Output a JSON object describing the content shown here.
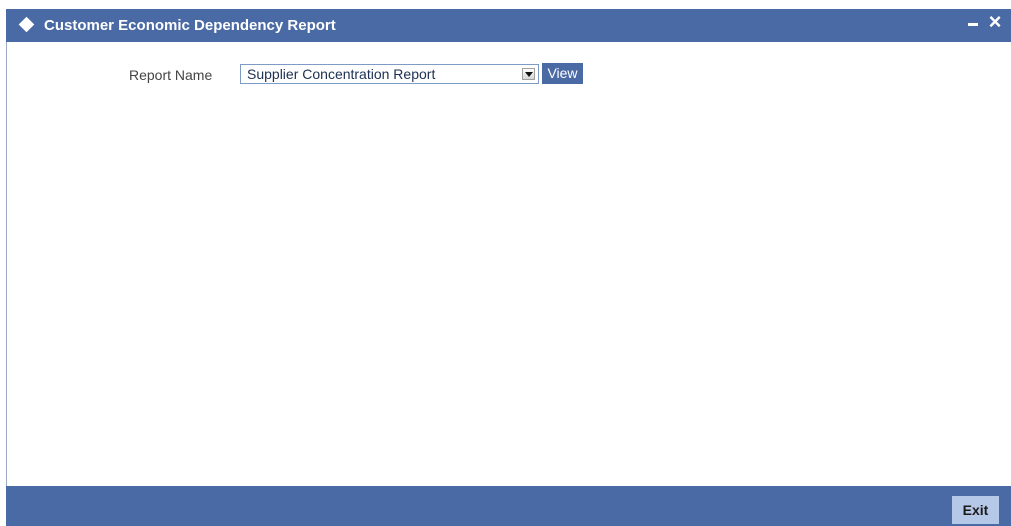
{
  "window": {
    "title": "Customer Economic Dependency Report",
    "controls": {
      "minimize_icon": "minimize-icon",
      "close_label": "×"
    }
  },
  "form": {
    "report_name_label": "Report Name",
    "report_name_value": "Supplier Concentration Report",
    "view_button_label": "View"
  },
  "footer": {
    "exit_button_label": "Exit"
  },
  "colors": {
    "titlebar": "#4a6aa5",
    "footer": "#4a6aa5",
    "view_button": "#4a6aa5",
    "exit_button": "#b6c8e8"
  }
}
